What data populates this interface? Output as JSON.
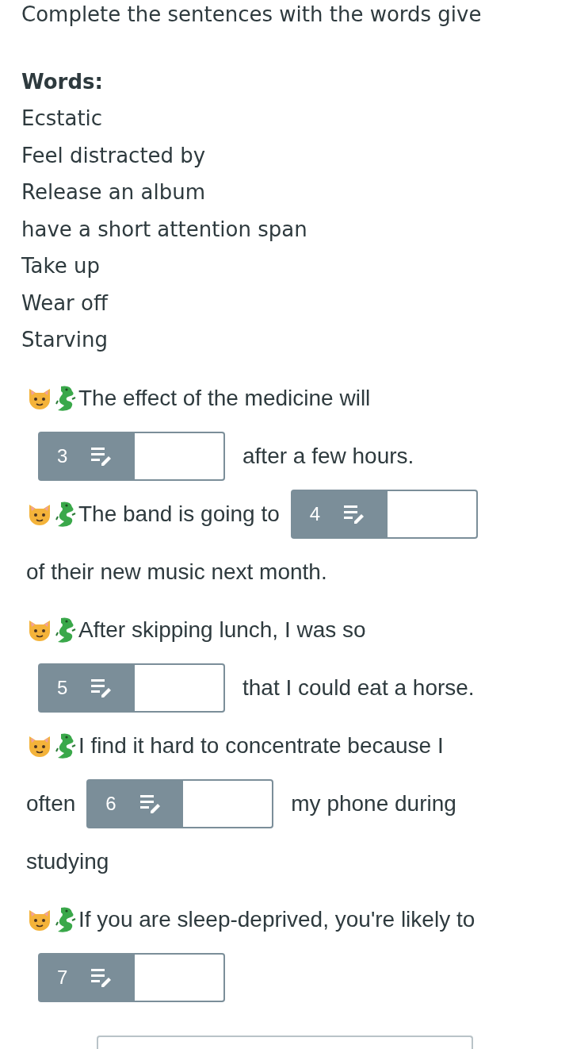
{
  "title": "Complete the sentences with the words give",
  "words": {
    "heading": "Words:",
    "items": [
      "Ecstatic",
      "Feel distracted by",
      "Release an album",
      "have a short attention span",
      "Take up",
      "Wear off",
      "Starving"
    ]
  },
  "questions": [
    {
      "lines": [
        [
          {
            "kind": "text",
            "text": "The effect of the medicine will"
          }
        ],
        [
          {
            "kind": "blank",
            "number": "3"
          },
          {
            "kind": "text",
            "text": "after a few hours."
          }
        ]
      ]
    },
    {
      "lines": [
        [
          {
            "kind": "text",
            "text": "The band is going to"
          },
          {
            "kind": "blank",
            "number": "4"
          }
        ],
        [
          {
            "kind": "text",
            "text": "of their new music next month."
          }
        ]
      ]
    },
    {
      "lines": [
        [
          {
            "kind": "text",
            "text": "After skipping lunch, I was so"
          }
        ],
        [
          {
            "kind": "blank",
            "number": "5"
          },
          {
            "kind": "text",
            "text": "that I could eat a horse."
          }
        ]
      ]
    },
    {
      "lines": [
        [
          {
            "kind": "text",
            "text": "I find it hard to concentrate because I"
          }
        ],
        [
          {
            "kind": "text",
            "text": "often"
          },
          {
            "kind": "blank",
            "number": "6"
          },
          {
            "kind": "text",
            "text": "my phone during"
          }
        ],
        [
          {
            "kind": "text",
            "text": "studying"
          }
        ]
      ]
    },
    {
      "lines": [
        [
          {
            "kind": "text",
            "text": "If you are sleep-deprived, you're likely to"
          }
        ],
        [
          {
            "kind": "blank",
            "number": "7"
          }
        ]
      ]
    }
  ]
}
